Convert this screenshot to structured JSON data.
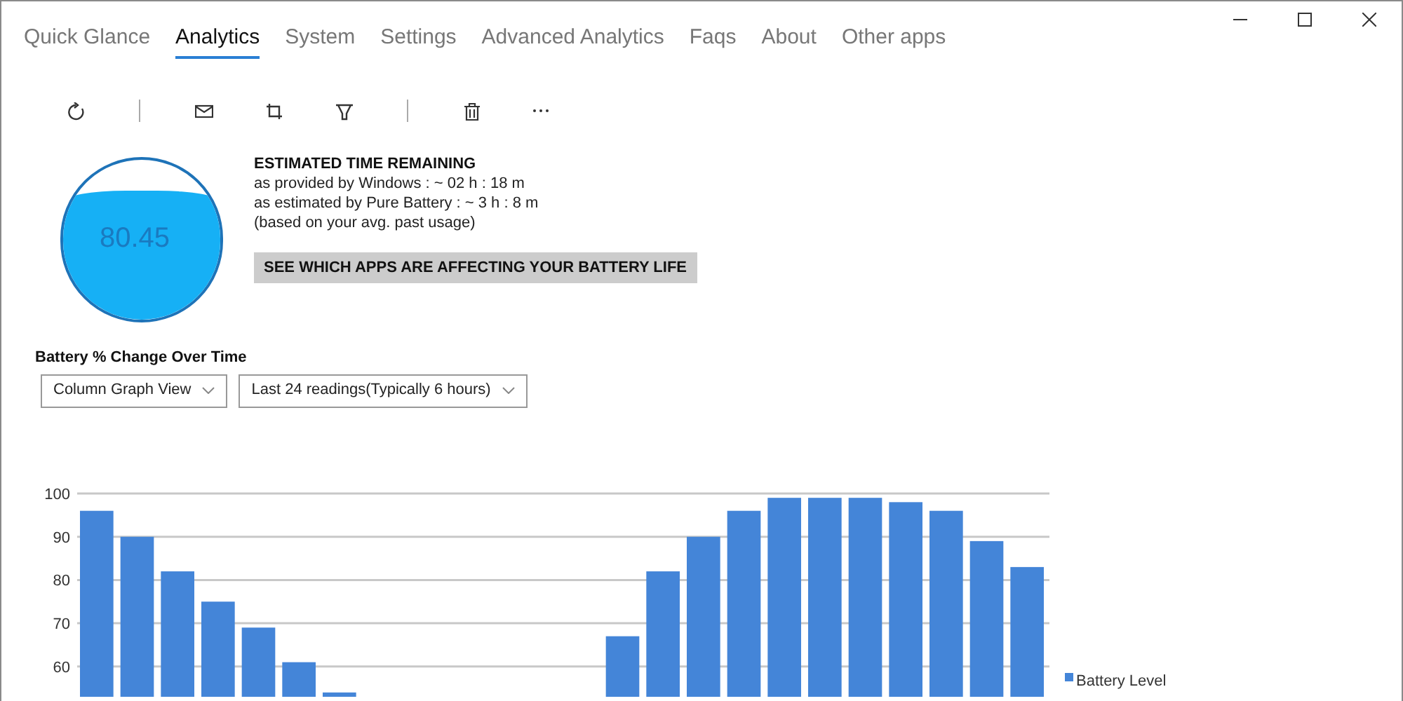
{
  "tabs": [
    {
      "label": "Quick Glance",
      "selected": false
    },
    {
      "label": "Analytics",
      "selected": true
    },
    {
      "label": "System",
      "selected": false
    },
    {
      "label": "Settings",
      "selected": false
    },
    {
      "label": "Advanced Analytics",
      "selected": false
    },
    {
      "label": "Faqs",
      "selected": false
    },
    {
      "label": "About",
      "selected": false
    },
    {
      "label": "Other apps",
      "selected": false
    }
  ],
  "toolbar": [
    {
      "kind": "refresh"
    },
    {
      "kind": "separator"
    },
    {
      "kind": "mail"
    },
    {
      "kind": "crop"
    },
    {
      "kind": "filter"
    },
    {
      "kind": "separator"
    },
    {
      "kind": "delete"
    },
    {
      "kind": "more"
    }
  ],
  "battery": {
    "level": 0.8045,
    "reading": "80.45"
  },
  "estimate": {
    "title": "ESTIMATED TIME REMAINING",
    "lines": [
      "as provided by Windows : ~ 02 h : 18 m",
      "as estimated by Pure Battery : ~ 3 h : 8 m",
      "(based on your avg. past usage)"
    ],
    "button": "SEE WHICH APPS ARE AFFECTING YOUR BATTERY LIFE"
  },
  "history": {
    "title": "Battery % Change Over Time",
    "view_dropdown": "Column Graph View",
    "range_dropdown": "Last 24 readings(Typically 6 hours)",
    "chart_data": {
      "type": "bar",
      "grid": true,
      "series": [
        {
          "name": "Battery Level",
          "color": "#4485d8",
          "values": [
            96,
            90,
            82,
            75,
            69,
            61,
            54,
            null,
            null,
            null,
            null,
            null,
            null,
            67,
            82,
            90,
            96,
            99,
            99,
            99,
            98,
            96,
            89,
            83
          ]
        }
      ],
      "ylim": [
        53,
        100
      ],
      "yticks": [
        60,
        70,
        80,
        90,
        100
      ]
    }
  }
}
